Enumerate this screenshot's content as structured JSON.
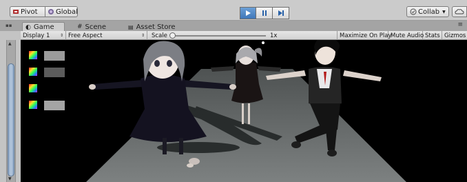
{
  "toolbar": {
    "pivot_label": "Pivot",
    "global_label": "Global",
    "collab_label": "Collab",
    "icons": [
      "pivot-icon",
      "global-icon",
      "play-icon",
      "pause-icon",
      "step-icon",
      "collab-check-icon",
      "cloud-icon"
    ],
    "play_active_color": "#3f77b9"
  },
  "tabs": [
    {
      "label": "Game",
      "icon": "game-icon",
      "active": true
    },
    {
      "label": "Scene",
      "icon": "scene-icon",
      "active": false
    },
    {
      "label": "Asset Store",
      "icon": "asset-store-icon",
      "active": false
    }
  ],
  "game_toolbar": {
    "display": "Display 1",
    "aspect": "Free Aspect",
    "scale_label": "Scale",
    "scale_value": "1x",
    "maximize": "Maximize On Play",
    "mute": "Mute Audio",
    "stats": "Stats",
    "gizmos": "Gizmos"
  },
  "viewport": {
    "background": "#000000",
    "characters": [
      "girl-left",
      "girl-middle",
      "boy-right"
    ]
  }
}
